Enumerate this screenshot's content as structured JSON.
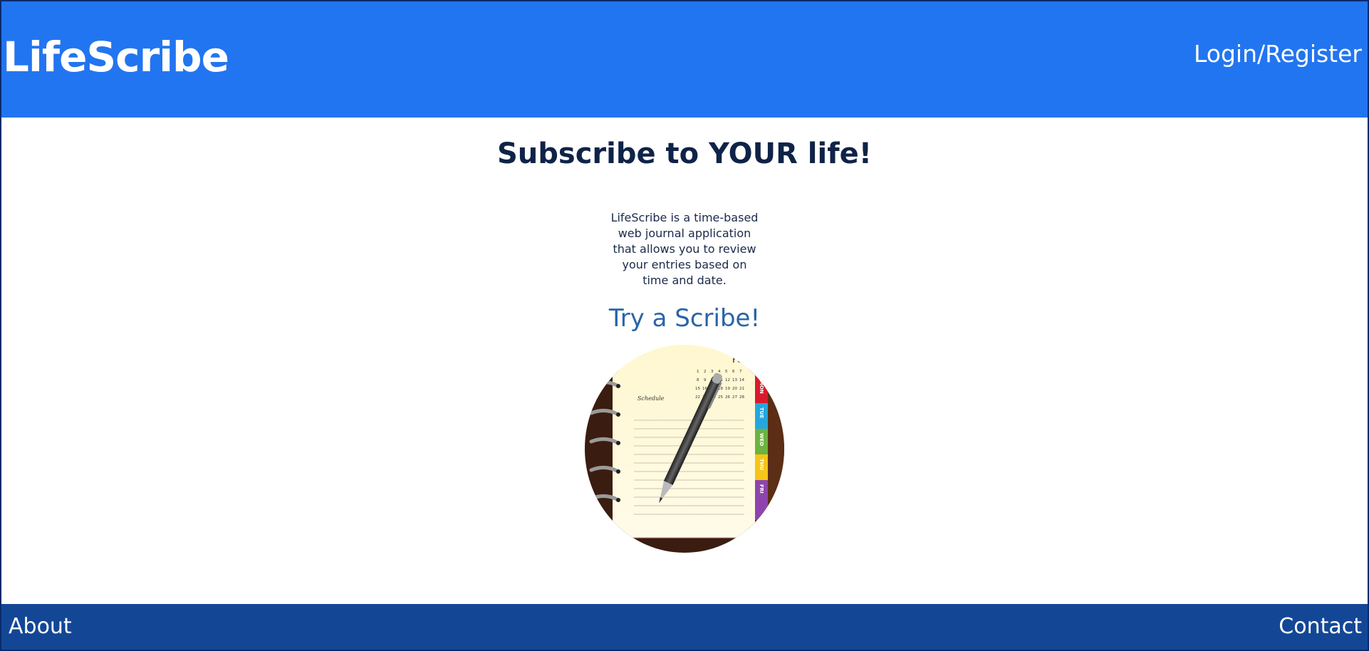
{
  "header": {
    "brand": "LifeScribe",
    "login_label": "Login/Register",
    "background_color": "#2275f0"
  },
  "main": {
    "headline": "Subscribe to YOUR life!",
    "description_lines": [
      "LifeScribe is a time-based",
      "web journal application",
      "that allows you to review",
      "your entries based on",
      "time and date."
    ],
    "cta": "Try a Scribe!",
    "illustration": {
      "icon": "planner-notebook-with-pen",
      "month": "Feb",
      "schedule_label": "Schedule",
      "tabs": [
        "MON",
        "TUE",
        "WED",
        "THU",
        "FRI"
      ],
      "tab_colors": [
        "#d81b2c",
        "#25a7de",
        "#6cb33f",
        "#f5c518",
        "#8e44ad"
      ],
      "calendar_rows": [
        [
          "1",
          "2",
          "3",
          "4",
          "5",
          "6",
          "7"
        ],
        [
          "8",
          "9",
          "10",
          "11",
          "12",
          "13",
          "14"
        ],
        [
          "15",
          "16",
          "17",
          "18",
          "19",
          "20",
          "21"
        ],
        [
          "22",
          "23",
          "24",
          "25",
          "26",
          "27",
          "28"
        ]
      ]
    }
  },
  "footer": {
    "about_label": "About",
    "contact_label": "Contact",
    "background_color": "#134796"
  }
}
